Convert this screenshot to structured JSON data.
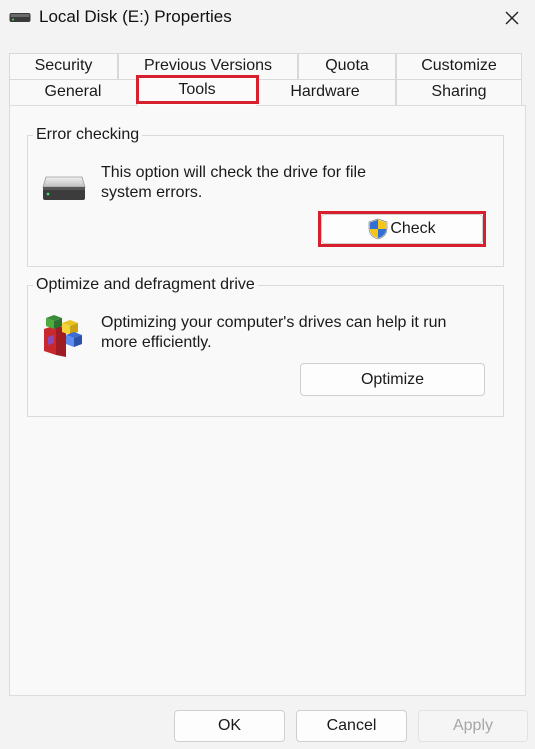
{
  "window": {
    "title": "Local Disk (E:) Properties",
    "icon": "drive-icon",
    "close_glyph": "✕"
  },
  "tabs": {
    "row1": [
      "Security",
      "Previous Versions",
      "Quota",
      "Customize"
    ],
    "row2": [
      "General",
      "Tools",
      "Hardware",
      "Sharing"
    ],
    "selected": "Tools"
  },
  "error_checking": {
    "title": "Error checking",
    "description_line1": "This option will check the drive for file",
    "description_line2": "system errors.",
    "icon": "drive-icon",
    "button_label": "Check",
    "button_icon": "uac-shield-icon"
  },
  "optimize": {
    "title": "Optimize and defragment drive",
    "description_line1": "Optimizing your computer's drives can help it run",
    "description_line2": "more efficiently.",
    "icon": "defrag-icon",
    "button_label": "Optimize"
  },
  "footer": {
    "ok_label": "OK",
    "cancel_label": "Cancel",
    "apply_label": "Apply"
  },
  "colors": {
    "highlight": "#d6202e",
    "background": "#f3f3f3",
    "panel": "#f9f9f9"
  }
}
